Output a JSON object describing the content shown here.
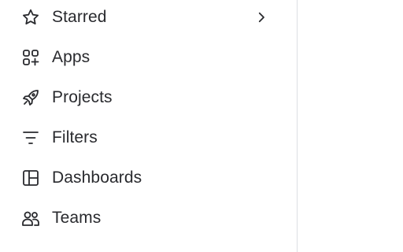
{
  "sidebar": {
    "items": [
      {
        "label": "Starred",
        "icon": "star-icon",
        "has_chevron": true
      },
      {
        "label": "Apps",
        "icon": "apps-icon"
      },
      {
        "label": "Projects",
        "icon": "rocket-icon"
      },
      {
        "label": "Filters",
        "icon": "filter-icon"
      },
      {
        "label": "Dashboards",
        "icon": "dashboard-icon"
      },
      {
        "label": "Teams",
        "icon": "people-icon"
      }
    ],
    "expand_icon": "chevron-right-icon"
  },
  "colors": {
    "text": "#292a2e",
    "icon": "#292a2e",
    "divider": "#dcdfe4",
    "background": "#ffffff"
  }
}
